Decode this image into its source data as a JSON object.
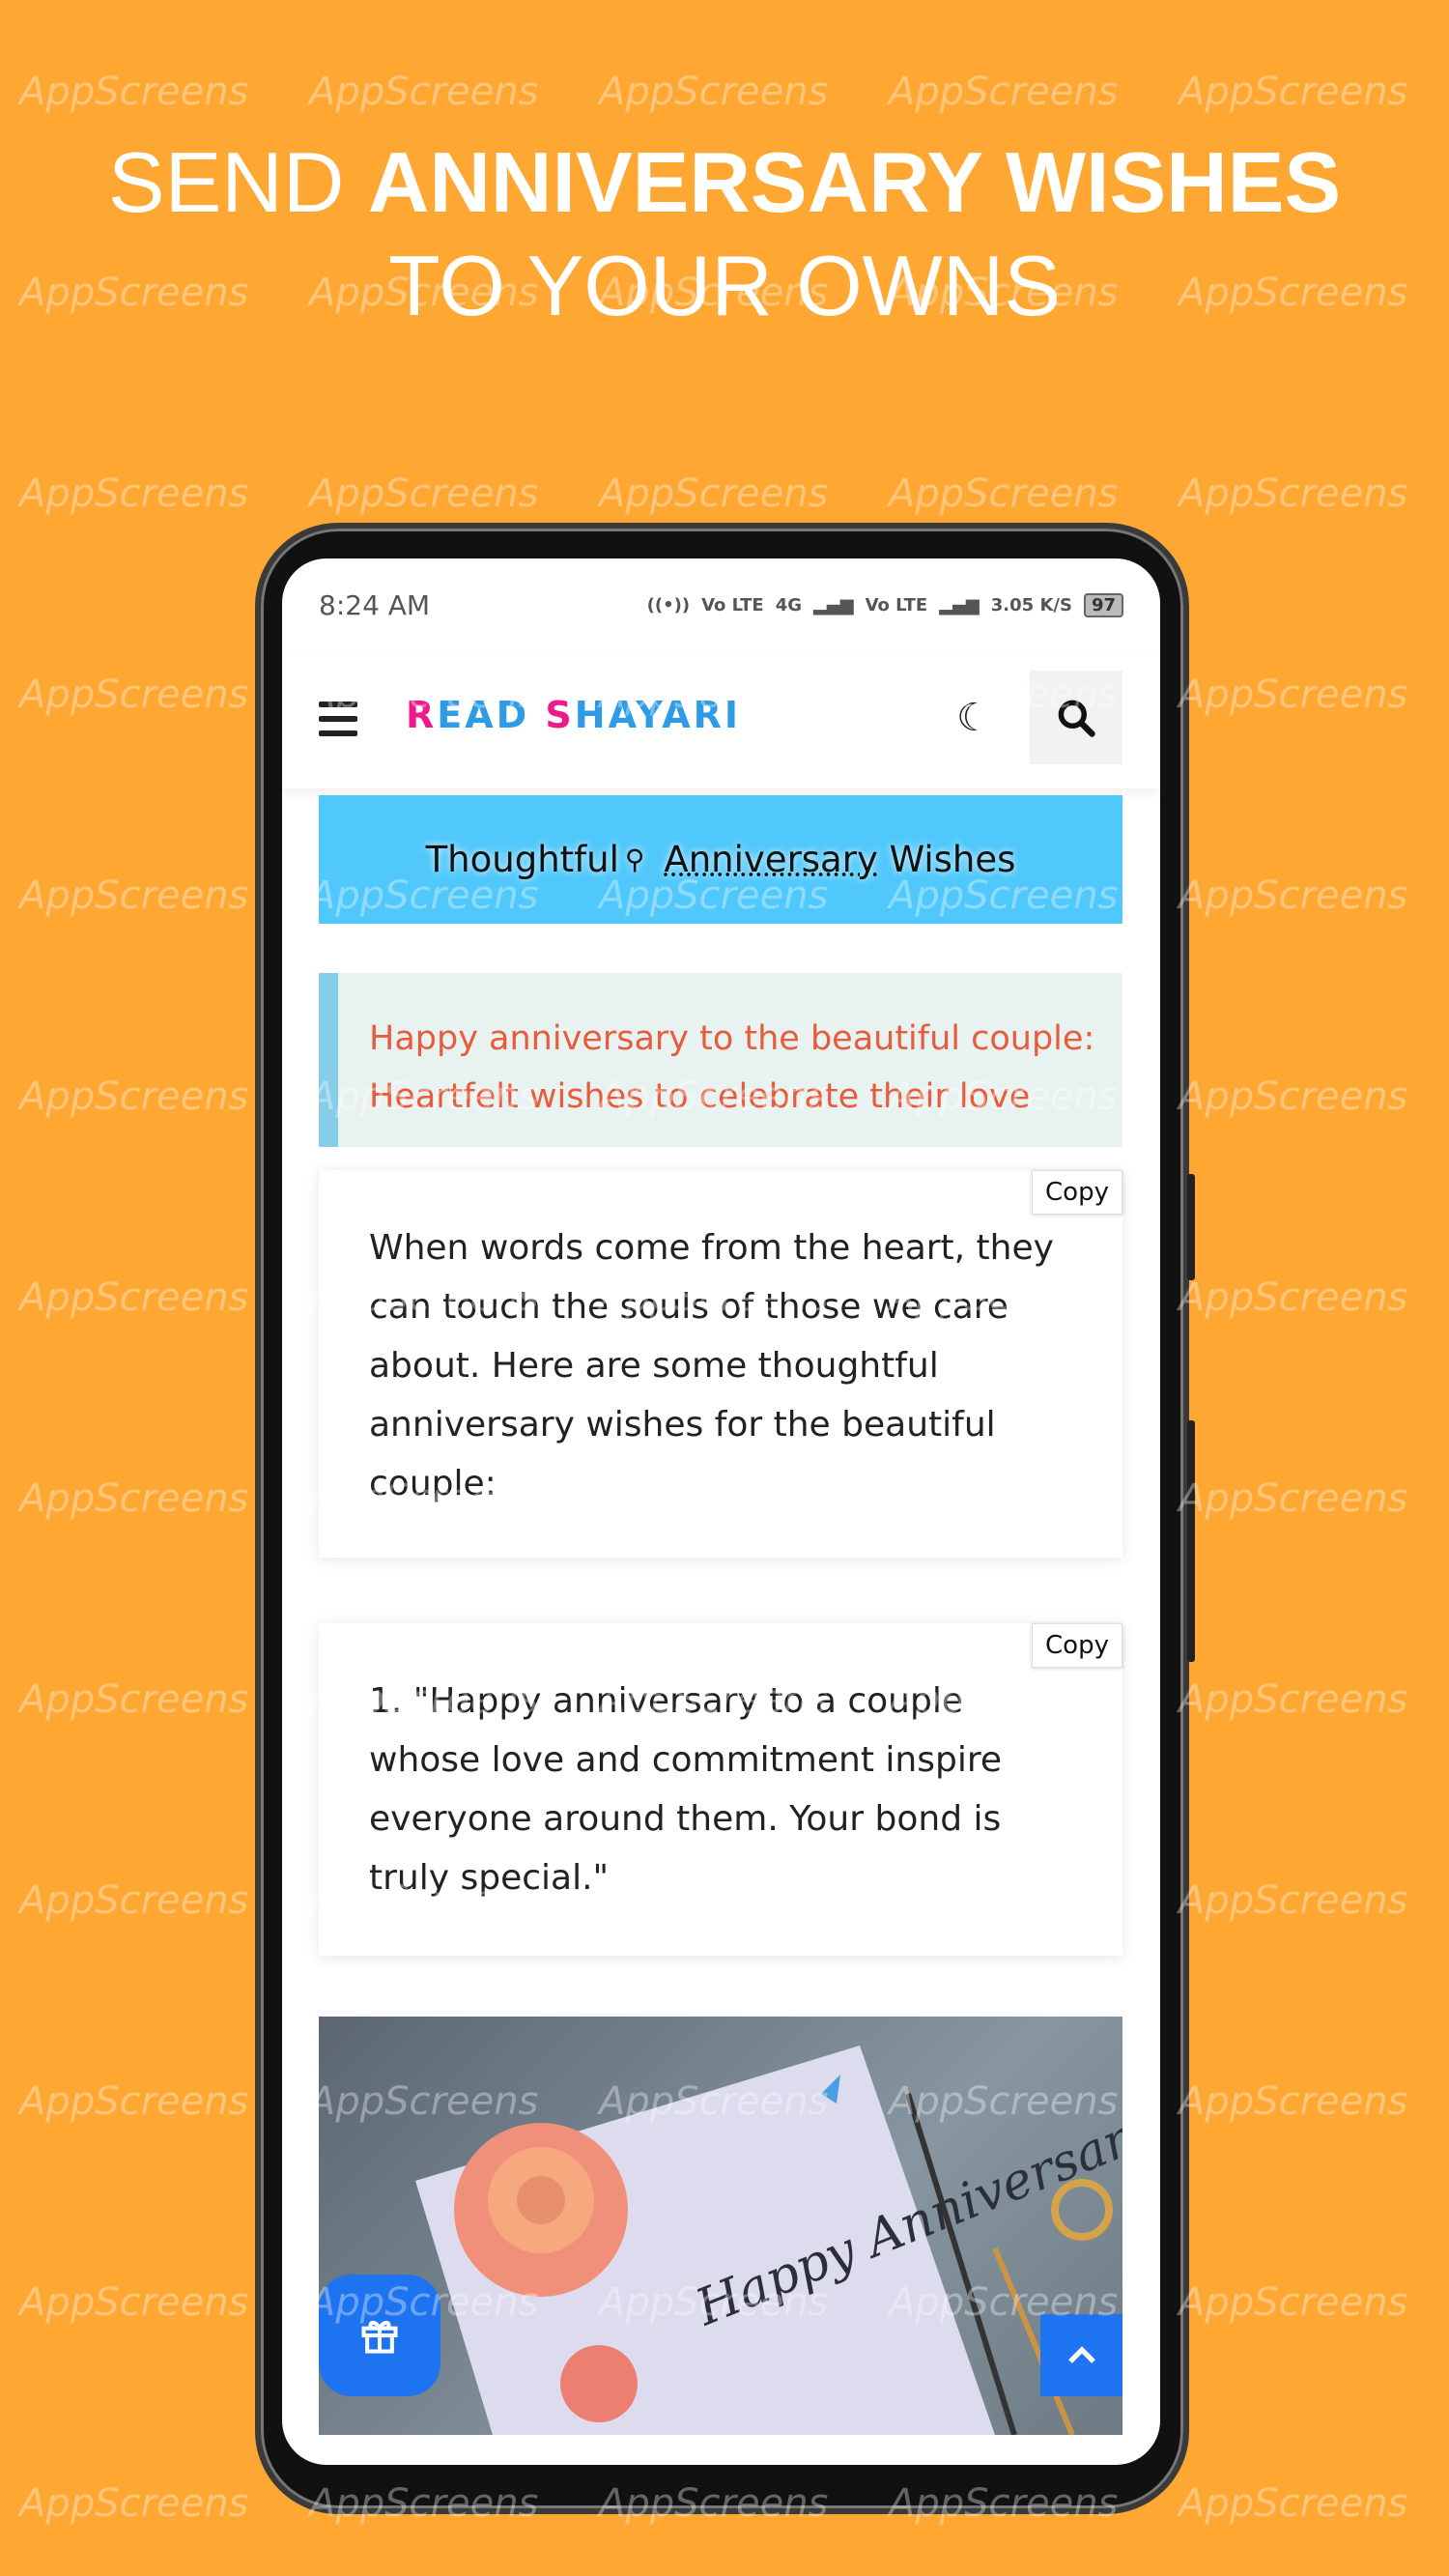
{
  "headline": {
    "line1_plain": "SEND ",
    "line1_bold": "ANNIVERSARY WISHES",
    "line2": "TO YOUR OWNS"
  },
  "watermark": "AppScreens",
  "status_bar": {
    "time": "8:24 AM",
    "net1": "Vo LTE",
    "net2": "4G",
    "net3": "Vo LTE",
    "speed": "3.05 K/S",
    "battery": "97"
  },
  "header": {
    "logo_part1": "R",
    "logo_part2": "EAD ",
    "logo_part3": "S",
    "logo_part4": "HAYARI",
    "menu_icon": "hamburger-icon",
    "theme_icon": "moon-icon",
    "search_icon": "search-icon"
  },
  "banner": {
    "word1": "Thoughtful",
    "word2": "Anniversary",
    "word3": " Wishes"
  },
  "quote": {
    "line1": "Happy anniversary to the beautiful couple:",
    "line2": "Heartfelt wishes to celebrate their love"
  },
  "cards": [
    {
      "copy_label": "Copy",
      "text": "When words come from the heart, they can touch the souls of those we care about. Here are some thoughtful anniversary wishes for the beautiful couple:"
    },
    {
      "copy_label": "Copy",
      "text": "1. \"Happy anniversary to a couple whose love and commitment inspire everyone around them. Your bond is truly special.\""
    }
  ],
  "image": {
    "card_text": "Happy Anniversary Sir"
  },
  "colors": {
    "background": "#FFA733",
    "accent": "#1E74F0",
    "banner": "#50C8FB",
    "quote_text": "#E85B3B"
  }
}
